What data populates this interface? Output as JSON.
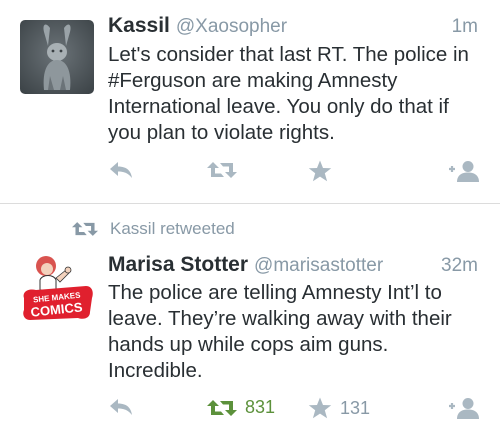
{
  "tweets": [
    {
      "name": "Kassil",
      "handle": "@Xaosopher",
      "time": "1m",
      "text": "Let's consider that last RT. The police in #Ferguson are making Amnesty International leave. You only do that if you plan to violate rights.",
      "avatar_icon": "rabbit-statue-photo"
    },
    {
      "retweeted_by": "Kassil retweeted",
      "name": "Marisa Stotter",
      "handle": "@marisastotter",
      "time": "32m",
      "text": "The police are telling Amnesty Int’l to leave. They’re walking away with their hands up while cops aim guns. Incredible.",
      "avatar_text": "SHE MAKES COMICS",
      "retweet_count": "831",
      "favorite_count": "131"
    }
  ],
  "colors": {
    "text": "#292f33",
    "muted": "#8899a6",
    "icon": "#aab8c2",
    "retweeted_green": "#5c913b",
    "brand_red": "#e0202e"
  }
}
